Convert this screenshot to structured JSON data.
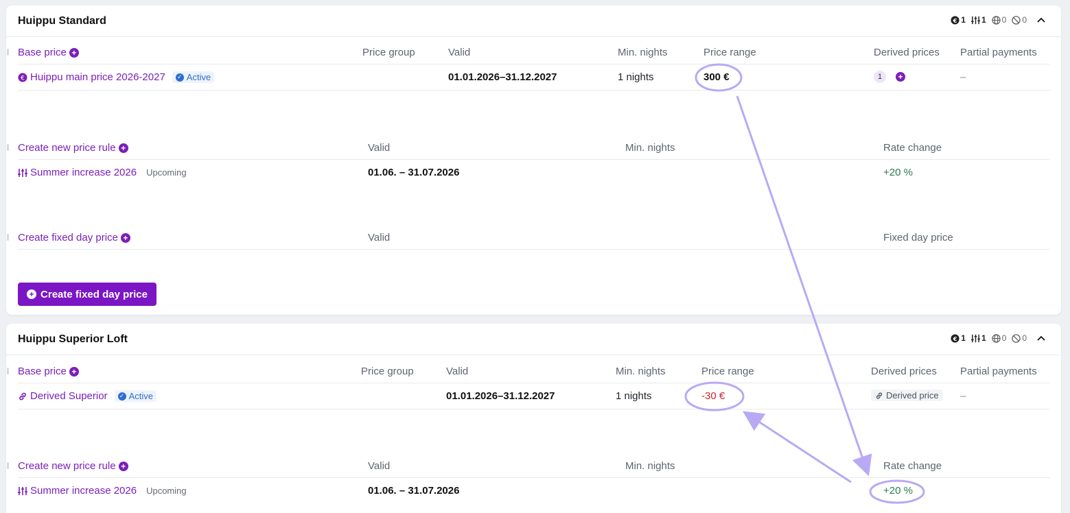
{
  "cards": [
    {
      "title": "Huippu Standard",
      "counts": {
        "base": "1",
        "rules": "1",
        "derived": "0",
        "blocked": "0"
      },
      "base_header": {
        "base_price_label": "Base price",
        "price_group": "Price group",
        "valid": "Valid",
        "min_nights": "Min. nights",
        "price_range": "Price range",
        "derived_prices": "Derived prices",
        "partial_payments": "Partial payments"
      },
      "base_row": {
        "name": "Huippu main price 2026-2027",
        "status": "Active",
        "valid": "01.01.2026–31.12.2027",
        "min_nights": "1 nights",
        "price_range": "300 €",
        "derived_count": "1",
        "partial": "–"
      },
      "rule_header": {
        "create_label": "Create new price rule",
        "valid": "Valid",
        "min_nights": "Min. nights",
        "rate_change": "Rate change"
      },
      "rule_row": {
        "name": "Summer increase 2026",
        "status": "Upcoming",
        "valid": "01.06. – 31.07.2026",
        "rate_change": "+20 %"
      },
      "fixed_header": {
        "create_label": "Create fixed day price",
        "valid": "Valid",
        "fixed_day_price": "Fixed day price"
      },
      "create_fixed_button": "Create fixed day price"
    },
    {
      "title": "Huippu Superior Loft",
      "counts": {
        "base": "1",
        "rules": "1",
        "derived": "0",
        "blocked": "0"
      },
      "base_header": {
        "base_price_label": "Base price",
        "price_group": "Price group",
        "valid": "Valid",
        "min_nights": "Min. nights",
        "price_range": "Price range",
        "derived_prices": "Derived prices",
        "partial_payments": "Partial payments"
      },
      "base_row": {
        "name": "Derived Superior",
        "status": "Active",
        "valid": "01.01.2026–31.12.2027",
        "min_nights": "1 nights",
        "price_range": "-30 €",
        "derived_badge": "Derived price",
        "partial": "–"
      },
      "rule_header": {
        "create_label": "Create new price rule",
        "valid": "Valid",
        "min_nights": "Min. nights",
        "rate_change": "Rate change"
      },
      "rule_row": {
        "name": "Summer increase 2026",
        "status": "Upcoming",
        "valid": "01.06. – 31.07.2026",
        "rate_change": "+20 %"
      }
    }
  ],
  "colors": {
    "accent": "#7b16c4",
    "annotation": "#b9a9f5",
    "positive": "#2b7a50",
    "negative": "#d21f2a",
    "active_badge": "#2e6ecf"
  },
  "icons": [
    "euro-circle-icon",
    "sliders-icon",
    "globe-icon",
    "blocked-icon",
    "chevron-up-icon",
    "plus-circle-icon",
    "check-circle-icon",
    "link-icon"
  ]
}
